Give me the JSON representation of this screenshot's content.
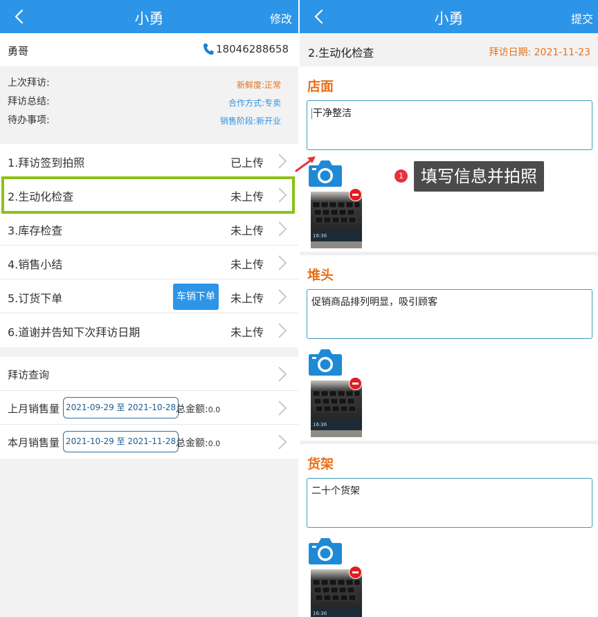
{
  "left": {
    "header": {
      "title": "小勇",
      "action": "修改"
    },
    "contact": {
      "name": "勇哥",
      "phone": "18046288658"
    },
    "summary": {
      "labels": [
        "上次拜访:",
        "拜访总结:",
        "待办事项:"
      ],
      "values": [
        {
          "text": "新鲜度:正常",
          "color": "#e8711d"
        },
        {
          "text": "合作方式:专卖",
          "color": "#2d95e8"
        },
        {
          "text": "销售阶段:新开业",
          "color": "#2d95e8"
        }
      ]
    },
    "steps": [
      {
        "label": "1.拜访签到拍照",
        "status": "已上传"
      },
      {
        "label": "2.生动化检查",
        "status": "未上传"
      },
      {
        "label": "3.库存检查",
        "status": "未上传"
      },
      {
        "label": "4.销售小结",
        "status": "未上传"
      },
      {
        "label": "5.订货下单",
        "status": "未上传",
        "button": "车销下单"
      },
      {
        "label": "6.道谢并告知下次拜访日期",
        "status": "未上传"
      }
    ],
    "query": {
      "title": "拜访查询",
      "rows": [
        {
          "label": "上月销售量",
          "range": "2021-09-29 至 2021-10-28",
          "total_label": "总金额:",
          "total": "0.0"
        },
        {
          "label": "本月销售量",
          "range": "2021-10-29 至 2021-11-28",
          "total_label": "总金额:",
          "total": "0.0"
        }
      ]
    }
  },
  "right": {
    "header": {
      "title": "小勇",
      "action": "提交"
    },
    "subheader": {
      "label": "2.生动化检查",
      "date_label": "拜访日期: 2021-11-23"
    },
    "sections": [
      {
        "title": "店面",
        "text": "干净整洁",
        "photo_time": "16:36"
      },
      {
        "title": "堆头",
        "text": "促销商品排列明显，吸引顾客",
        "photo_time": "16:36"
      },
      {
        "title": "货架",
        "text": "二十个货架",
        "photo_time": "16:36"
      }
    ]
  },
  "annotation": {
    "badge": "1",
    "text": "填写信息并拍照"
  },
  "colors": {
    "primary": "#2d95e8",
    "accent": "#ea6e16",
    "highlight": "#8cc115",
    "danger": "#e21d22"
  },
  "icons": [
    "back-icon",
    "phone-icon",
    "chevron-right-icon",
    "camera-icon",
    "remove-icon",
    "arrow-icon"
  ]
}
